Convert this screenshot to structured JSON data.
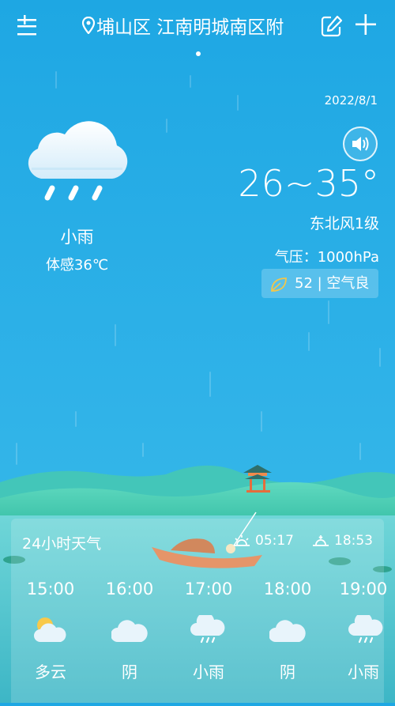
{
  "header": {
    "location": "埔山区 江南明城南区附",
    "menu_icon": "menu-icon",
    "edit_icon": "edit-icon",
    "add_icon": "plus-icon"
  },
  "current": {
    "date": "2022/8/1",
    "temp_range": "26~35°",
    "wind": "东北风1级",
    "pressure": "气压：1000hPa",
    "aqi": "52 | 空气良",
    "condition": "小雨",
    "feels_like": "体感36℃",
    "voice_icon": "speaker-icon",
    "weather_icon": "rain-cloud-icon"
  },
  "forecast": {
    "title": "24小时天气",
    "sunrise": "05:17",
    "sunset": "18:53",
    "hours": [
      {
        "time": "15:00",
        "cond": "多云",
        "icon": "partly-cloudy-icon"
      },
      {
        "time": "16:00",
        "cond": "阴",
        "icon": "cloud-icon"
      },
      {
        "time": "17:00",
        "cond": "小雨",
        "icon": "rain-cloud-icon"
      },
      {
        "time": "18:00",
        "cond": "阴",
        "icon": "cloud-icon"
      },
      {
        "time": "19:00",
        "cond": "小雨",
        "icon": "rain-cloud-icon"
      }
    ]
  },
  "colors": {
    "sky_top": "#1ea7e3",
    "sky_bottom": "#3bbde9",
    "aqi_leaf": "#f3c64a",
    "hill": "#3ec9a8"
  }
}
